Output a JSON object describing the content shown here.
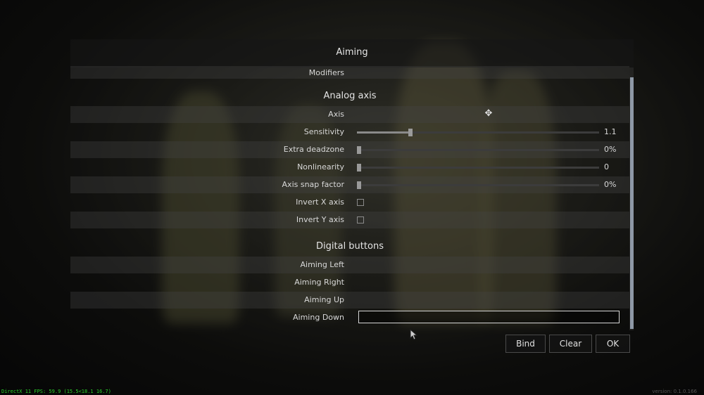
{
  "dialog": {
    "title": "Aiming",
    "top_row_label": "Modifiers",
    "sections": {
      "analog": "Analog axis",
      "digital": "Digital buttons"
    },
    "analog_rows": {
      "axis": {
        "label": "Axis"
      },
      "sensitivity": {
        "label": "Sensitivity",
        "value": "1.1",
        "level": 0.22
      },
      "extra_deadzone": {
        "label": "Extra deadzone",
        "value": "0%",
        "level": 0.0
      },
      "nonlinearity": {
        "label": "Nonlinearity",
        "value": "0",
        "level": 0.0
      },
      "axis_snap": {
        "label": "Axis snap factor",
        "value": "0%",
        "level": 0.0
      },
      "invert_x": {
        "label": "Invert X axis",
        "checked": false
      },
      "invert_y": {
        "label": "Invert Y axis",
        "checked": false
      }
    },
    "digital_rows": {
      "aiming_left": "Aiming Left",
      "aiming_right": "Aiming Right",
      "aiming_up": "Aiming Up",
      "aiming_down": "Aiming Down"
    },
    "buttons": {
      "bind": "Bind",
      "clear": "Clear",
      "ok": "OK"
    }
  },
  "overlay": {
    "fps": "DirectX 11 FPS: 59.9 (15.5<18.1 16.7)",
    "version": "version: 0.1.0.166"
  },
  "colors": {
    "scrollbar": "#8e98a6",
    "fps_text": "#2bd12b"
  }
}
